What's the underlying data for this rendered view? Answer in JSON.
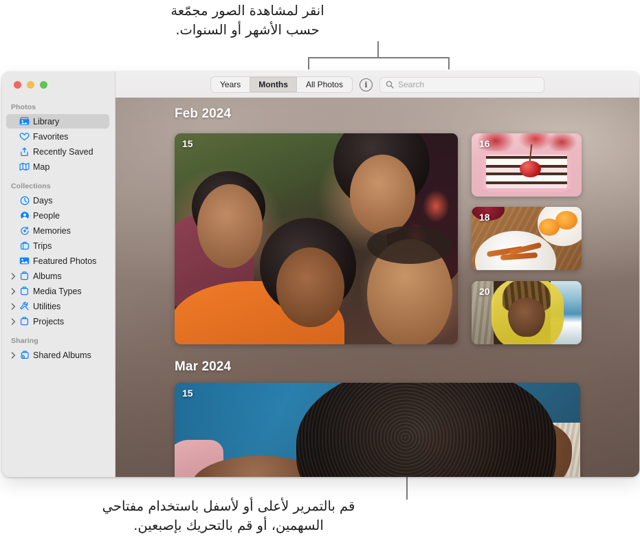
{
  "callouts": {
    "top": "انقر لمشاهدة الصور مجمّعة\nحسب الأشهر أو السنوات.",
    "bottom": "قم بالتمرير لأعلى أو لأسفل باستخدام مفتاحي\nالسهمين، أو قم بالتحريك بإصبعين."
  },
  "window": {
    "traffic_lights": [
      "close",
      "minimize",
      "zoom"
    ]
  },
  "sidebar": {
    "sections": [
      {
        "title": "Photos",
        "items": [
          {
            "label": "Library",
            "icon": "library-icon",
            "selected": true,
            "disclosure": false
          },
          {
            "label": "Favorites",
            "icon": "heart-icon",
            "selected": false,
            "disclosure": false
          },
          {
            "label": "Recently Saved",
            "icon": "recently-saved-icon",
            "selected": false,
            "disclosure": false
          },
          {
            "label": "Map",
            "icon": "map-icon",
            "selected": false,
            "disclosure": false
          }
        ]
      },
      {
        "title": "Collections",
        "items": [
          {
            "label": "Days",
            "icon": "clock-icon",
            "selected": false,
            "disclosure": false
          },
          {
            "label": "People",
            "icon": "person-circle-icon",
            "selected": false,
            "disclosure": false
          },
          {
            "label": "Memories",
            "icon": "memories-icon",
            "selected": false,
            "disclosure": false
          },
          {
            "label": "Trips",
            "icon": "trips-icon",
            "selected": false,
            "disclosure": false
          },
          {
            "label": "Featured Photos",
            "icon": "featured-photos-icon",
            "selected": false,
            "disclosure": false
          },
          {
            "label": "Albums",
            "icon": "album-icon",
            "selected": false,
            "disclosure": true
          },
          {
            "label": "Media Types",
            "icon": "album-icon",
            "selected": false,
            "disclosure": true
          },
          {
            "label": "Utilities",
            "icon": "utilities-icon",
            "selected": false,
            "disclosure": true
          },
          {
            "label": "Projects",
            "icon": "album-icon",
            "selected": false,
            "disclosure": true
          }
        ]
      },
      {
        "title": "Sharing",
        "items": [
          {
            "label": "Shared Albums",
            "icon": "shared-album-icon",
            "selected": false,
            "disclosure": true
          }
        ]
      }
    ]
  },
  "toolbar": {
    "segments": [
      {
        "label": "Years",
        "active": false
      },
      {
        "label": "Months",
        "active": true
      },
      {
        "label": "All Photos",
        "active": false
      }
    ],
    "info_label": "i",
    "search": {
      "placeholder": "Search",
      "value": ""
    }
  },
  "content": {
    "months": [
      {
        "title": "Feb 2024",
        "hero": {
          "day": "15",
          "art": "art-group"
        },
        "thumbs": [
          {
            "day": "16",
            "art": "art-cake"
          },
          {
            "day": "18",
            "art": "art-plate"
          },
          {
            "day": "20",
            "art": "art-beach"
          }
        ]
      },
      {
        "title": "Mar 2024",
        "hero": {
          "day": "15",
          "art": "art-studio"
        },
        "thumbs": []
      }
    ]
  },
  "colors": {
    "accent": "#0b84ff",
    "sidebar_bg": "#e9e9e9",
    "selected_row": "#d0d0d0",
    "traffic_red": "#ec6a5e",
    "traffic_yellow": "#f4bd4f",
    "traffic_green": "#61c454",
    "leader_line": "#7b7b7b",
    "text": "#1d1d1f"
  }
}
